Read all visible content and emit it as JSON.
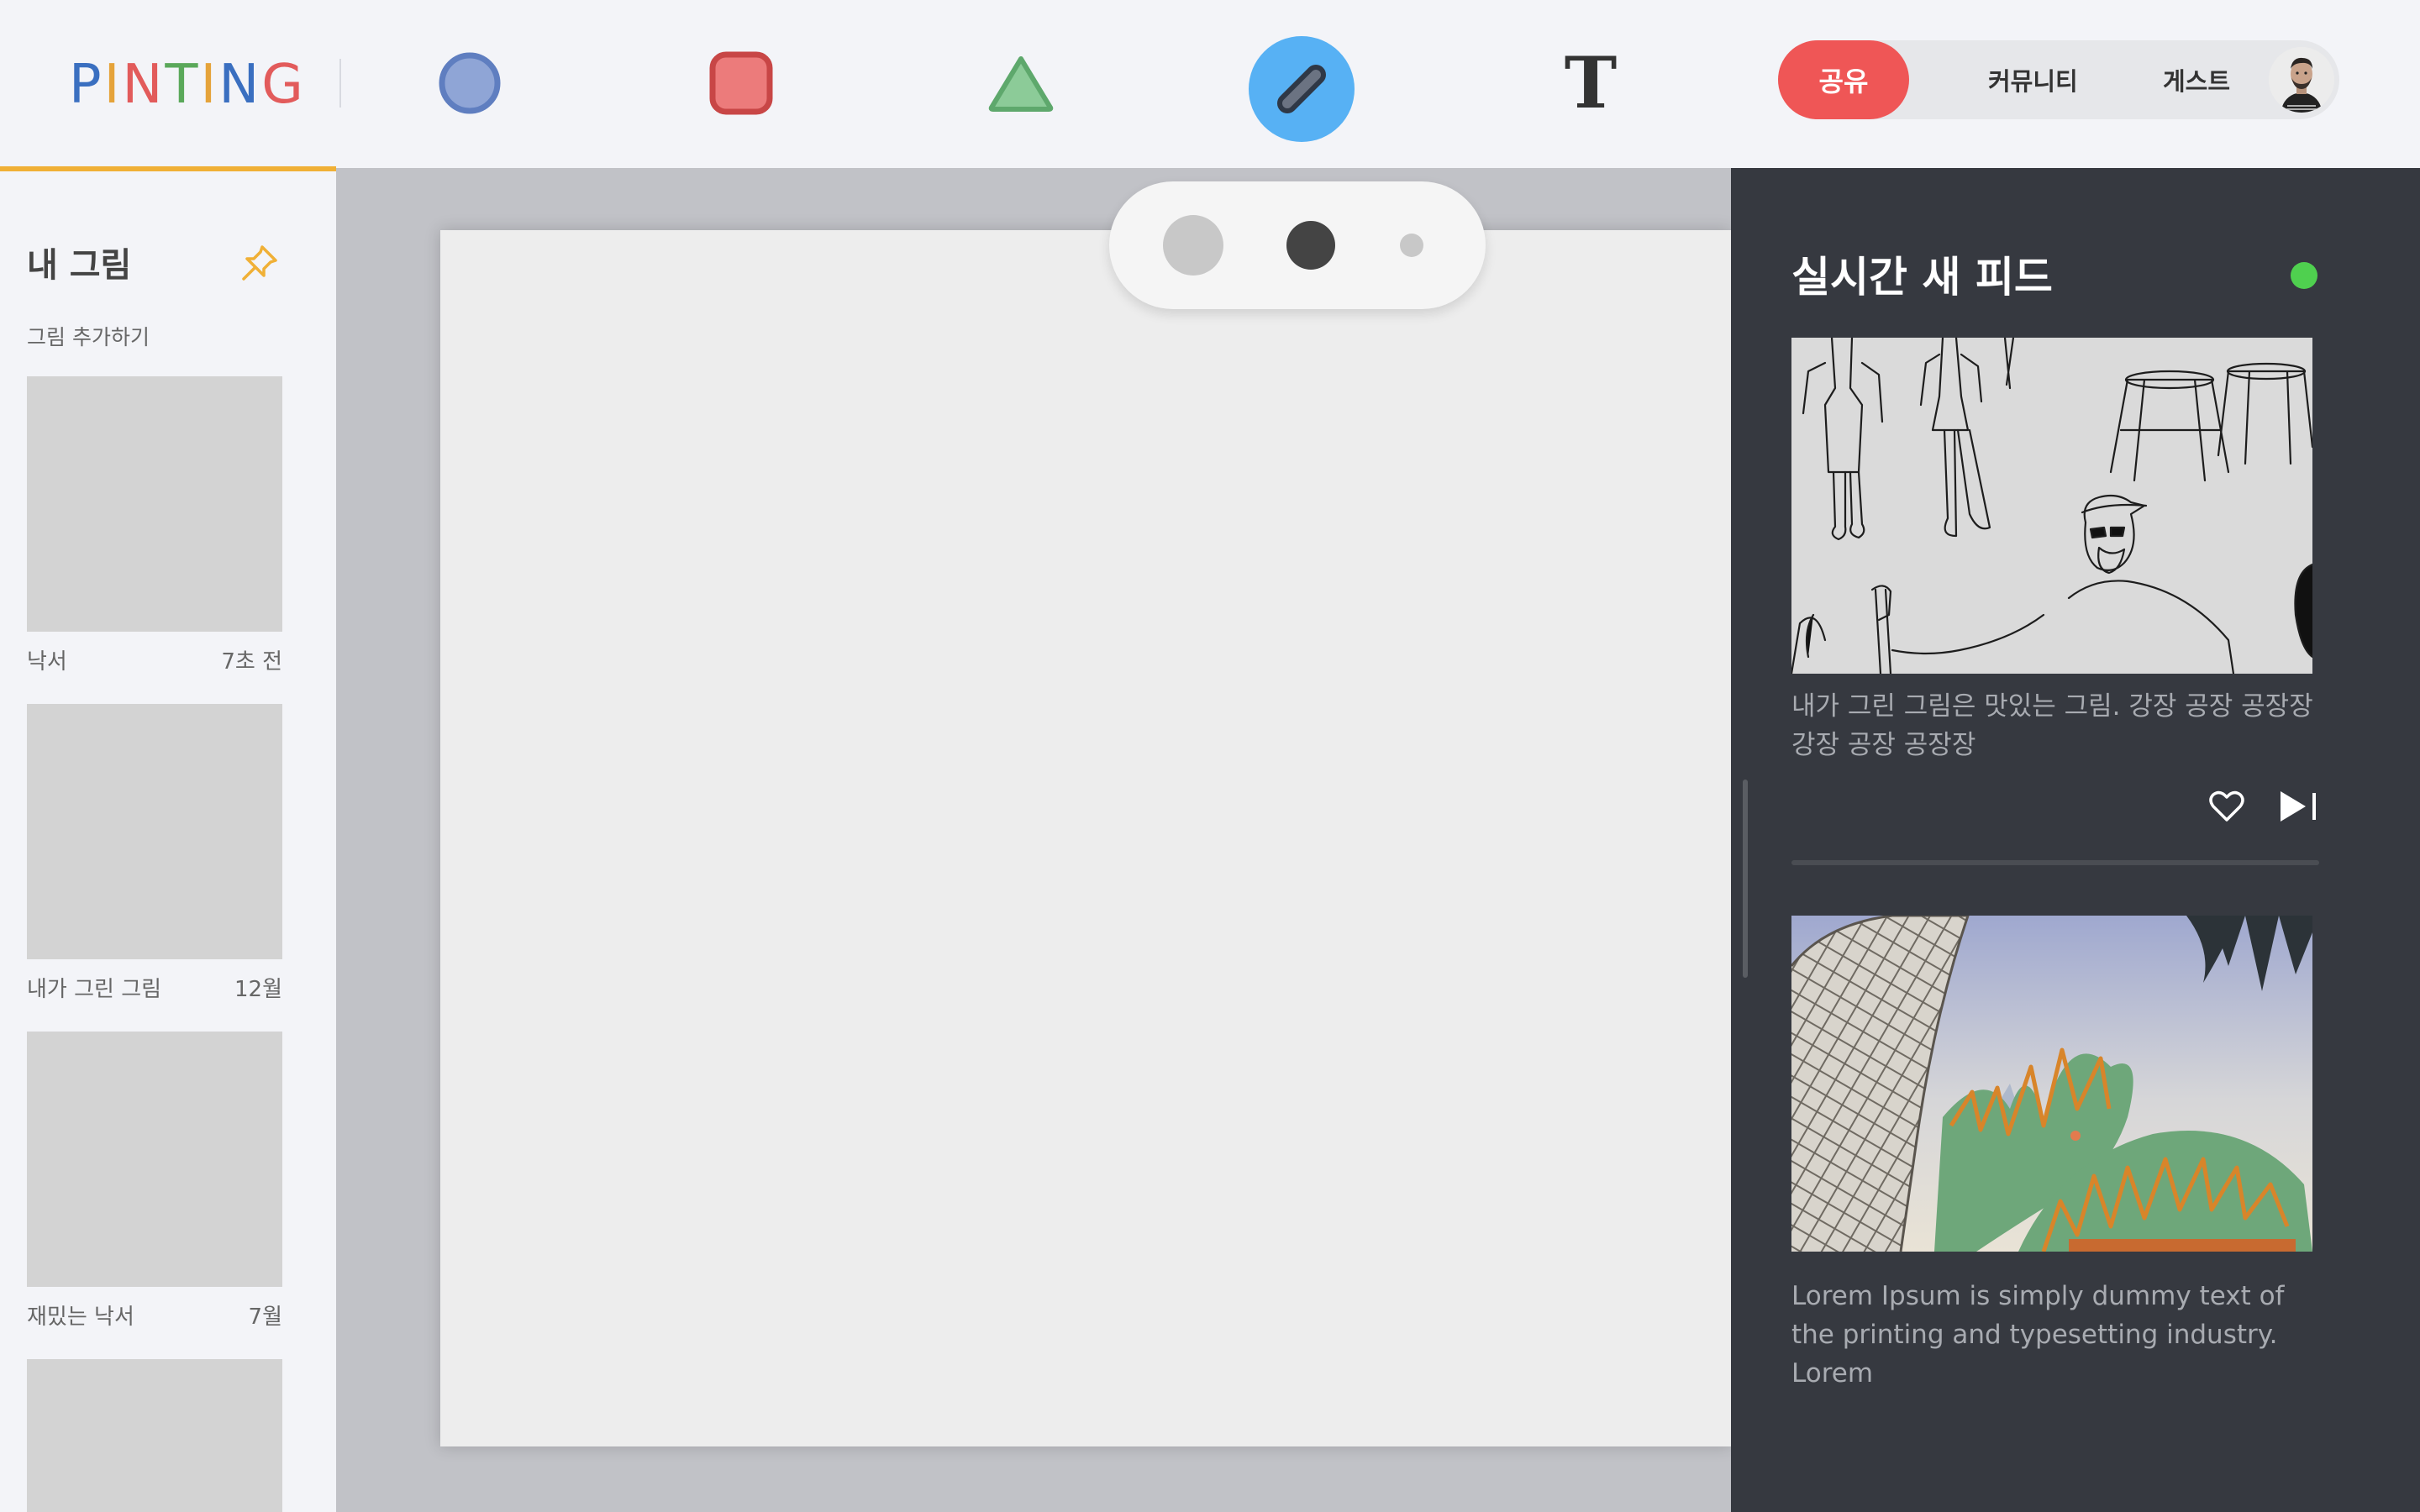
{
  "app": {
    "logo_letters": [
      {
        "char": "P",
        "color": "#3a6fc0"
      },
      {
        "char": "I",
        "color": "#e5a33a"
      },
      {
        "char": "N",
        "color": "#e25b5b"
      },
      {
        "char": "T",
        "color": "#5aa85a"
      },
      {
        "char": "I",
        "color": "#e5a33a"
      },
      {
        "char": "N",
        "color": "#3a6fc0"
      },
      {
        "char": "G",
        "color": "#e25b5b"
      }
    ]
  },
  "toolbar": {
    "tools": [
      {
        "name": "circle-tool",
        "icon": "circle-icon",
        "fill": "#8fa5d6",
        "stroke": "#5f7ec0",
        "active": false
      },
      {
        "name": "rectangle-tool",
        "icon": "rounded-square-icon",
        "fill": "#ec7b7b",
        "stroke": "#c84646",
        "active": false
      },
      {
        "name": "triangle-tool",
        "icon": "triangle-icon",
        "fill": "#8ccb98",
        "stroke": "#5ea86c",
        "active": false
      },
      {
        "name": "pen-tool",
        "icon": "pen-icon",
        "fill": "#3d4656",
        "stroke": "#3d4656",
        "active": true
      },
      {
        "name": "text-tool",
        "icon": "text-icon",
        "glyph": "T",
        "active": false
      }
    ]
  },
  "nav": {
    "share": "공유",
    "community": "커뮤니티",
    "guest": "게스트",
    "share_color": "#ef5656"
  },
  "sidebar": {
    "title": "내 그림",
    "add_label": "그림 추가하기",
    "accent_color": "#f0b036",
    "drawings": [
      {
        "name": "낙서",
        "time": "7초 전"
      },
      {
        "name": "내가 그린 그림",
        "time": "12월"
      },
      {
        "name": "재밌는 낙서",
        "time": "7월"
      },
      {
        "name": "",
        "time": ""
      }
    ]
  },
  "brush_sizes": [
    {
      "name": "large",
      "color": "#c8c8c8"
    },
    {
      "name": "medium",
      "color": "#444444"
    },
    {
      "name": "small",
      "color": "#c8c8c8"
    }
  ],
  "feed": {
    "title": "실시간 새 피드",
    "live_color": "#4fd04f",
    "posts": [
      {
        "text": "내가 그린 그림은 맛있는 그림. 강장 공장 공장장 강장 공장 공장장"
      },
      {
        "text": "Lorem Ipsum is simply dummy text of the printing and typesetting industry. Lorem"
      }
    ]
  }
}
